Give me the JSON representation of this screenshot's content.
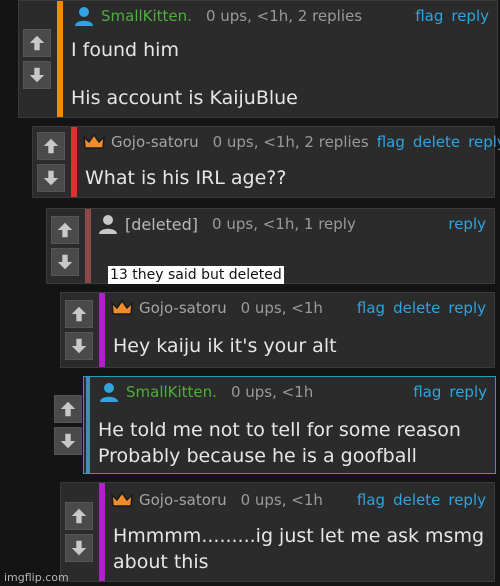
{
  "comments": [
    {
      "user": "SmallKitten.",
      "meta": "0 ups, <1h, 2 replies",
      "actions": [
        "flag",
        "reply"
      ],
      "lines": [
        "I found him",
        "His account is KaijuBlue"
      ],
      "stripe": "#f08c00"
    },
    {
      "user": "Gojo-satoru",
      "meta": "0 ups, <1h, 2 replies",
      "actions": [
        "flag",
        "delete",
        "reply"
      ],
      "lines": [
        "What is his IRL age??"
      ],
      "stripe": "#e03030"
    },
    {
      "user": "[deleted]",
      "meta": "0 ups, <1h, 1 reply",
      "actions": [
        "reply"
      ],
      "lines": [],
      "stripe": "#8a4b48"
    },
    {
      "user": "Gojo-satoru",
      "meta": "0 ups, <1h",
      "actions": [
        "flag",
        "delete",
        "reply"
      ],
      "lines": [
        "Hey kaiju ik it's your alt"
      ],
      "stripe": "#b020c8"
    },
    {
      "user": "SmallKitten.",
      "meta": "0 ups, <1h",
      "actions": [
        "flag",
        "reply"
      ],
      "lines": [
        "He told me not to tell for some reason",
        "Probably because he is a goofball"
      ],
      "stripe": "#4a8aa8"
    },
    {
      "user": "Gojo-satoru",
      "meta": "0 ups, <1h",
      "actions": [
        "flag",
        "delete",
        "reply"
      ],
      "lines": [
        "Hmmmm.........ig just let me ask msmg",
        "about this"
      ],
      "stripe": "#b020c8"
    }
  ],
  "overlay_text": "13 they said but deleted",
  "watermark": "imgflip.com",
  "colors": {
    "link": "#2fa4e0",
    "green_user": "#4fae3d",
    "crown": "#f08c2a",
    "user_icon": "#2fa4e0"
  }
}
